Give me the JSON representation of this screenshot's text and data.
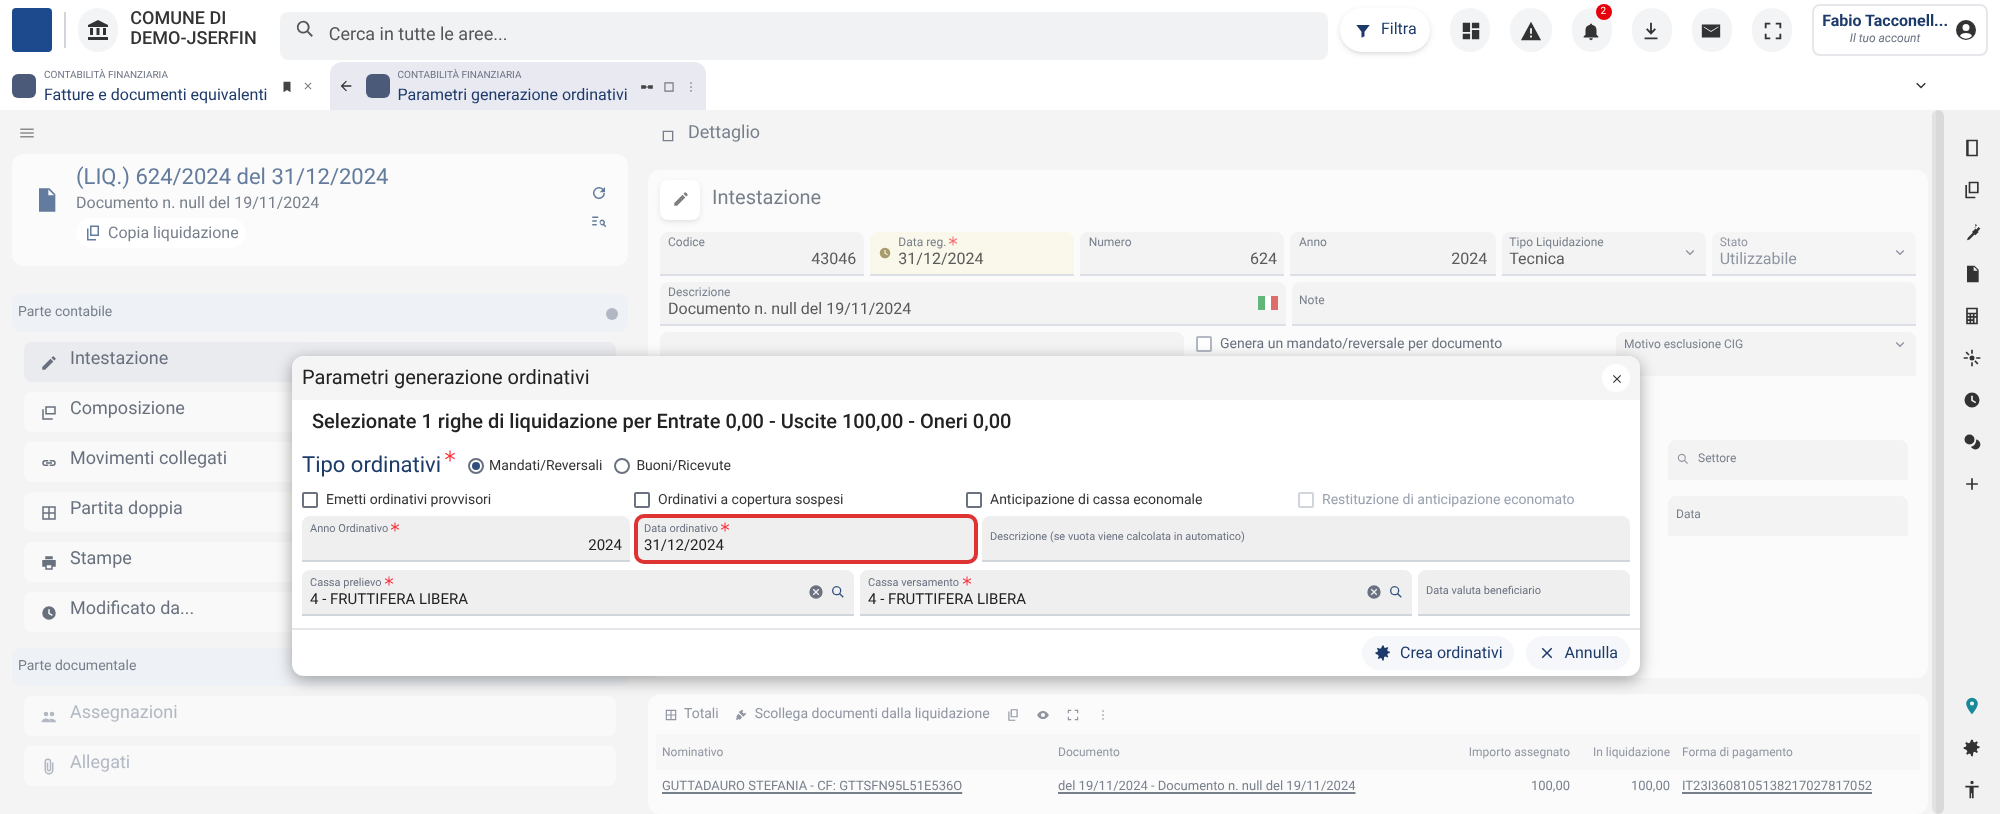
{
  "topbar": {
    "org_lines": [
      "COMUNE DI",
      "DEMO-JSERFIN"
    ],
    "search_placeholder": "Cerca in tutte le aree...",
    "filter": "Filtra",
    "notification_count": "2",
    "user": "Fabio Tacconell...",
    "account": "Il tuo account"
  },
  "tabs": [
    {
      "category": "CONTABILITÀ FINANZIARIA",
      "title": "Fatture e documenti equivalenti",
      "selected": false
    },
    {
      "category": "CONTABILITÀ FINANZIARIA",
      "title": "Parametri generazione ordinativi",
      "selected": true
    }
  ],
  "left_panel": {
    "title": "(LIQ.) 624/2024 del 31/12/2024",
    "subtitle": "Documento n. null del 19/11/2024",
    "copy_button": "Copia liquidazione",
    "sections": [
      {
        "title": "Parte contabile",
        "items": [
          {
            "label": "Intestazione",
            "kind": "edit",
            "selected": true,
            "disabled": false
          },
          {
            "label": "Composizione",
            "kind": "layers",
            "selected": false,
            "disabled": false
          },
          {
            "label": "Movimenti collegati",
            "kind": "link",
            "selected": false,
            "disabled": false
          },
          {
            "label": "Partita doppia",
            "kind": "grid",
            "selected": false,
            "disabled": false
          },
          {
            "label": "Stampe",
            "kind": "print",
            "selected": false,
            "disabled": false
          },
          {
            "label": "Modificato da...",
            "kind": "history",
            "selected": false,
            "disabled": false
          }
        ]
      },
      {
        "title": "Parte documentale",
        "items": [
          {
            "label": "Assegnazioni",
            "kind": "people",
            "selected": false,
            "disabled": true
          },
          {
            "label": "Allegati",
            "kind": "attach",
            "selected": false,
            "disabled": true
          }
        ]
      }
    ]
  },
  "detail": {
    "header": "Dettaglio",
    "section_title": "Intestazione",
    "row_1": [
      {
        "label": "Codice",
        "value": "43046",
        "kind": "number",
        "required": false,
        "disabled": false
      },
      {
        "label": "Data reg.",
        "value": "31/12/2024",
        "kind": "date",
        "required": true,
        "disabled": false
      },
      {
        "label": "Numero",
        "value": "624",
        "kind": "number",
        "required": false,
        "disabled": false
      },
      {
        "label": "Anno",
        "value": "2024",
        "kind": "number",
        "required": false,
        "disabled": false
      },
      {
        "label": "Tipo Liquidazione",
        "value": "Tecnica",
        "kind": "select",
        "required": false,
        "disabled": false
      },
      {
        "label": "Stato",
        "value": "Utilizzabile",
        "kind": "select",
        "required": false,
        "disabled": true
      }
    ],
    "description": {
      "label": "Descrizione",
      "value": "Documento n. null del 19/11/2024"
    },
    "note": {
      "label": "Note"
    },
    "per_document": {
      "label": "Genera un mandato/reversale per documento",
      "checked": false
    },
    "cig_reason": {
      "label": "Motivo esclusione CIG"
    },
    "side_labels": [
      "Settore",
      "Data"
    ]
  },
  "table": {
    "toolbar": [
      "Totali",
      "Scollega documenti dalla liquidazione"
    ],
    "columns": [
      "Nominativo",
      "Documento",
      "Importo assegnato",
      "In liquidazione",
      "Forma di pagamento"
    ],
    "rows": [
      [
        "GUTTADAURO STEFANIA - CF: GTTSFN95L51E536O",
        "del 19/11/2024 - Documento n. null del 19/11/2024",
        "100,00",
        "100,00",
        "IT23I3608105138217027817052"
      ]
    ]
  },
  "modal": {
    "title": "Parametri generazione ordinativi",
    "summary": "Selezionate 1 righe di liquidazione per Entrate 0,00 - Uscite 100,00 - Oneri 0,00",
    "type_label": "Tipo ordinativi",
    "type_required": true,
    "radios": [
      {
        "label": "Mandati/Reversali",
        "selected": true
      },
      {
        "label": "Buoni/Ricevute",
        "selected": false
      }
    ],
    "checkboxes": [
      {
        "label": "Emetti ordinativi provvisori",
        "checked": false,
        "disabled": false
      },
      {
        "label": "Ordinativi a copertura sospesi",
        "checked": false,
        "disabled": false
      },
      {
        "label": "Anticipazione di cassa economale",
        "checked": false,
        "disabled": false
      },
      {
        "label": "Restituzione di anticipazione economato",
        "checked": false,
        "disabled": true
      }
    ],
    "fields": [
      {
        "label": "Anno Ordinativo",
        "value": "2024",
        "kind": "number",
        "required": true,
        "highlighted": false
      },
      {
        "label": "Data ordinativo",
        "value": "31/12/2024",
        "kind": "date",
        "required": true,
        "highlighted": true
      },
      {
        "label": "Descrizione (se vuota viene calcolata in automatico)",
        "kind": "text",
        "required": false,
        "highlighted": false
      },
      {
        "label": "Cassa prelievo",
        "value": "4 - FRUTTIFERA LIBERA",
        "kind": "lookup",
        "required": true,
        "highlighted": false
      },
      {
        "label": "Cassa versamento",
        "value": "4 - FRUTTIFERA LIBERA",
        "kind": "lookup",
        "required": true,
        "highlighted": false
      },
      {
        "label": "Data valuta beneficiario",
        "kind": "date",
        "required": false,
        "highlighted": false
      }
    ],
    "buttons": [
      {
        "label": "Crea ordinativi",
        "kind": "gear"
      },
      {
        "label": "Annulla",
        "kind": "close"
      }
    ]
  }
}
